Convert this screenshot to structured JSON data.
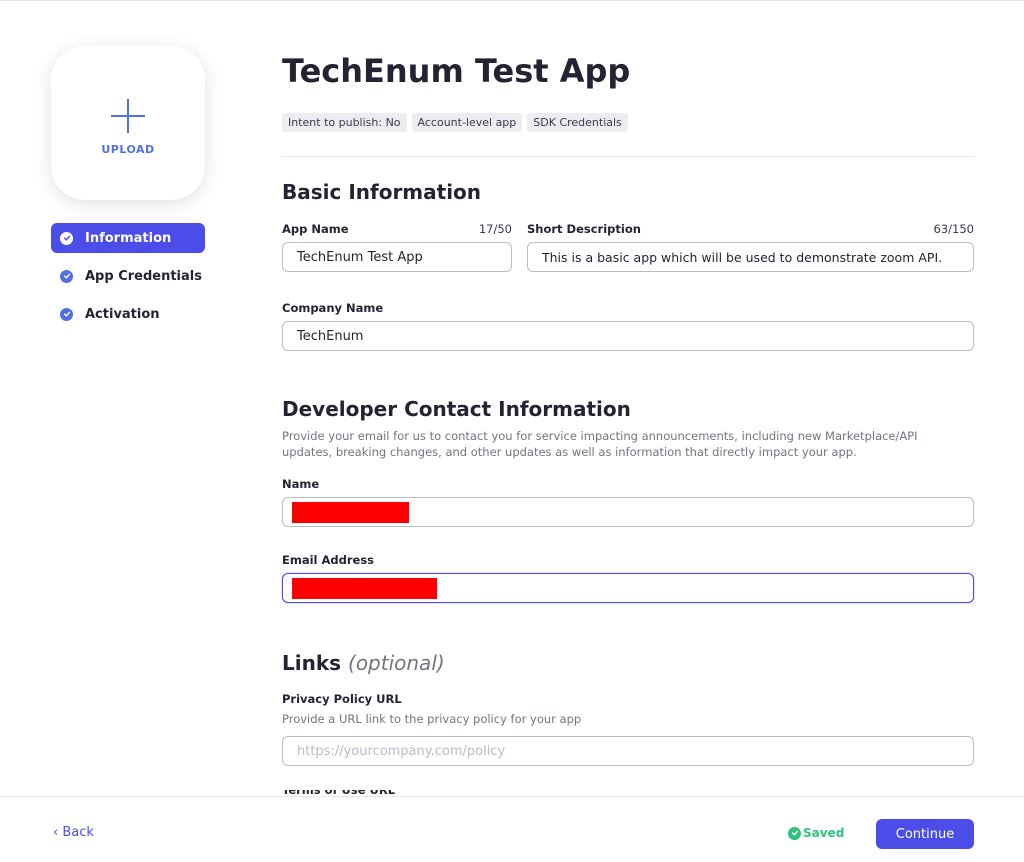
{
  "sidebar": {
    "upload_label": "UPLOAD",
    "items": [
      {
        "label": "Information",
        "active": true
      },
      {
        "label": "App Credentials",
        "active": false
      },
      {
        "label": "Activation",
        "active": false
      }
    ]
  },
  "header": {
    "title": "TechEnum Test App",
    "tags": [
      "Intent to publish: No",
      "Account-level app",
      "SDK Credentials"
    ]
  },
  "basic_info": {
    "title": "Basic Information",
    "app_name": {
      "label": "App Name",
      "counter": "17/50",
      "value": "TechEnum Test App"
    },
    "short_description": {
      "label": "Short Description",
      "counter": "63/150",
      "value": "This is a basic app which will be used to demonstrate zoom API."
    },
    "company_name": {
      "label": "Company Name",
      "value": "TechEnum"
    }
  },
  "developer_contact": {
    "title": "Developer Contact Information",
    "description": "Provide your email for us to contact you for service impacting announcements, including new Marketplace/API updates, breaking changes, and other updates as well as information that directly impact your app.",
    "name": {
      "label": "Name",
      "value_redacted": true
    },
    "email": {
      "label": "Email Address",
      "value_redacted": true
    }
  },
  "links": {
    "title": "Links",
    "title_optional": "(optional)",
    "privacy_policy": {
      "label": "Privacy Policy URL",
      "help": "Provide a URL link to the privacy policy for your app",
      "placeholder": "https://yourcompany.com/policy"
    },
    "next_label_partial": "Terms of Use URL"
  },
  "footer": {
    "back_label": "Back",
    "saved_label": "Saved",
    "continue_label": "Continue"
  },
  "colors": {
    "accent": "#4b4de8",
    "link_blue": "#4f6fe6",
    "saved_green": "#2ec27e",
    "redaction": "#ff0000"
  }
}
